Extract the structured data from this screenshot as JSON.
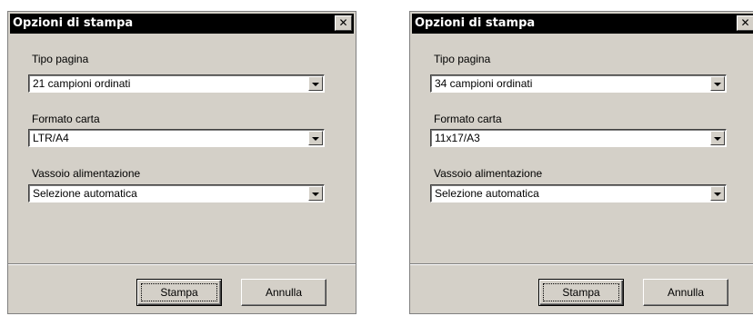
{
  "dialogs": [
    {
      "title": "Opzioni di stampa",
      "close_icon": "close-icon",
      "fields": [
        {
          "label": "Tipo pagina",
          "value": "21 campioni ordinati"
        },
        {
          "label": "Formato carta",
          "value": "LTR/A4"
        },
        {
          "label": "Vassoio alimentazione",
          "value": "Selezione automatica"
        }
      ],
      "buttons": {
        "print": "Stampa",
        "cancel": "Annulla"
      }
    },
    {
      "title": "Opzioni di stampa",
      "close_icon": "close-icon",
      "fields": [
        {
          "label": "Tipo pagina",
          "value": "34 campioni ordinati"
        },
        {
          "label": "Formato carta",
          "value": "11x17/A3"
        },
        {
          "label": "Vassoio alimentazione",
          "value": "Selezione automatica"
        }
      ],
      "buttons": {
        "print": "Stampa",
        "cancel": "Annulla"
      }
    }
  ],
  "colors": {
    "dialog_face": "#d4d0c8",
    "titlebar": "#000000",
    "title_text": "#ffffff",
    "field_background": "#ffffff"
  }
}
